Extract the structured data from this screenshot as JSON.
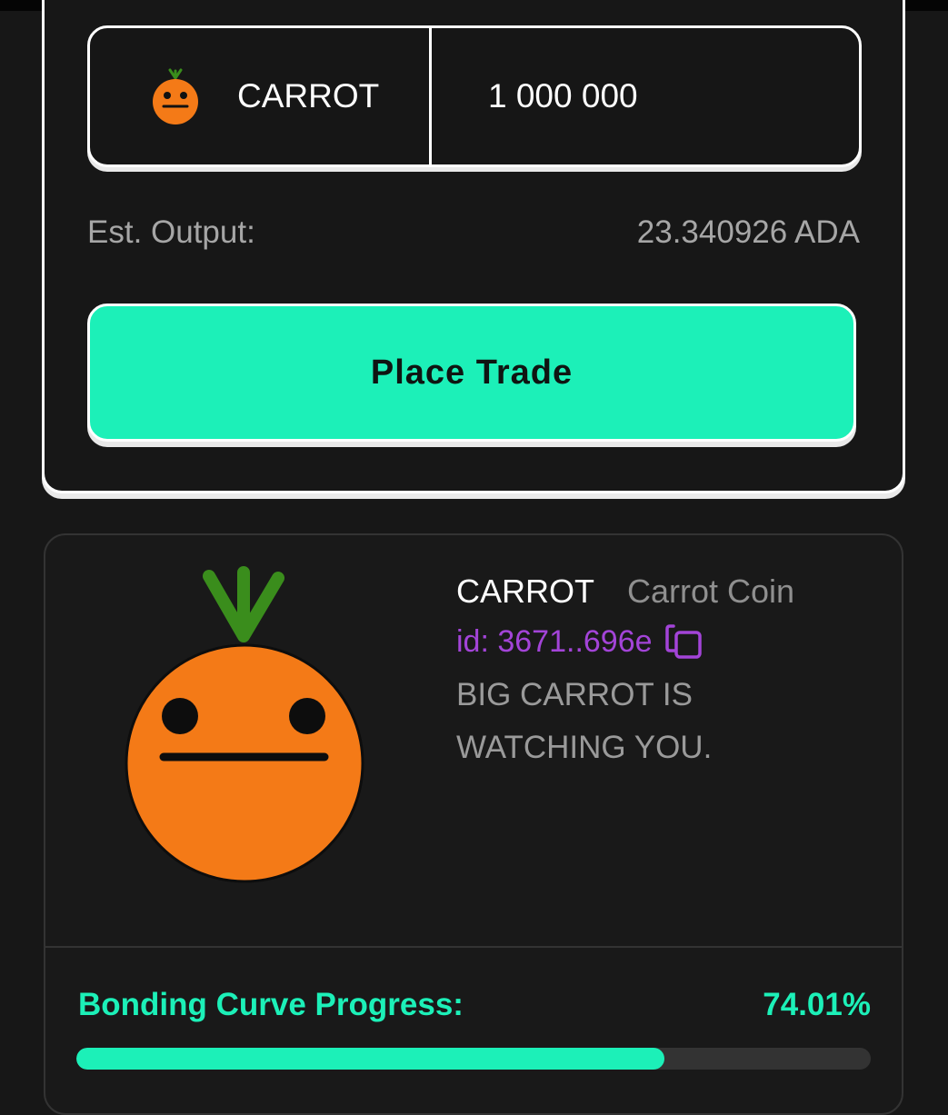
{
  "trade": {
    "token_symbol": "CARROT",
    "amount": "1 000 000",
    "est_output_label": "Est. Output:",
    "est_output_value": "23.340926 ADA",
    "place_trade_label": "Place Trade"
  },
  "token": {
    "ticker": "CARROT",
    "name": "Carrot Coin",
    "id": "id: 3671..696e",
    "description": "BIG CARROT IS WATCHING YOU.",
    "image_icon": "carrot-face-icon"
  },
  "progress": {
    "label": "Bonding Curve Progress:",
    "percent_text": "74.01%",
    "fraction": 0.7401
  },
  "colors": {
    "accent": "#1cf0b8",
    "id_link": "#a344d8",
    "carrot_orange": "#f47a17",
    "leaf_green": "#3a8d1c"
  }
}
